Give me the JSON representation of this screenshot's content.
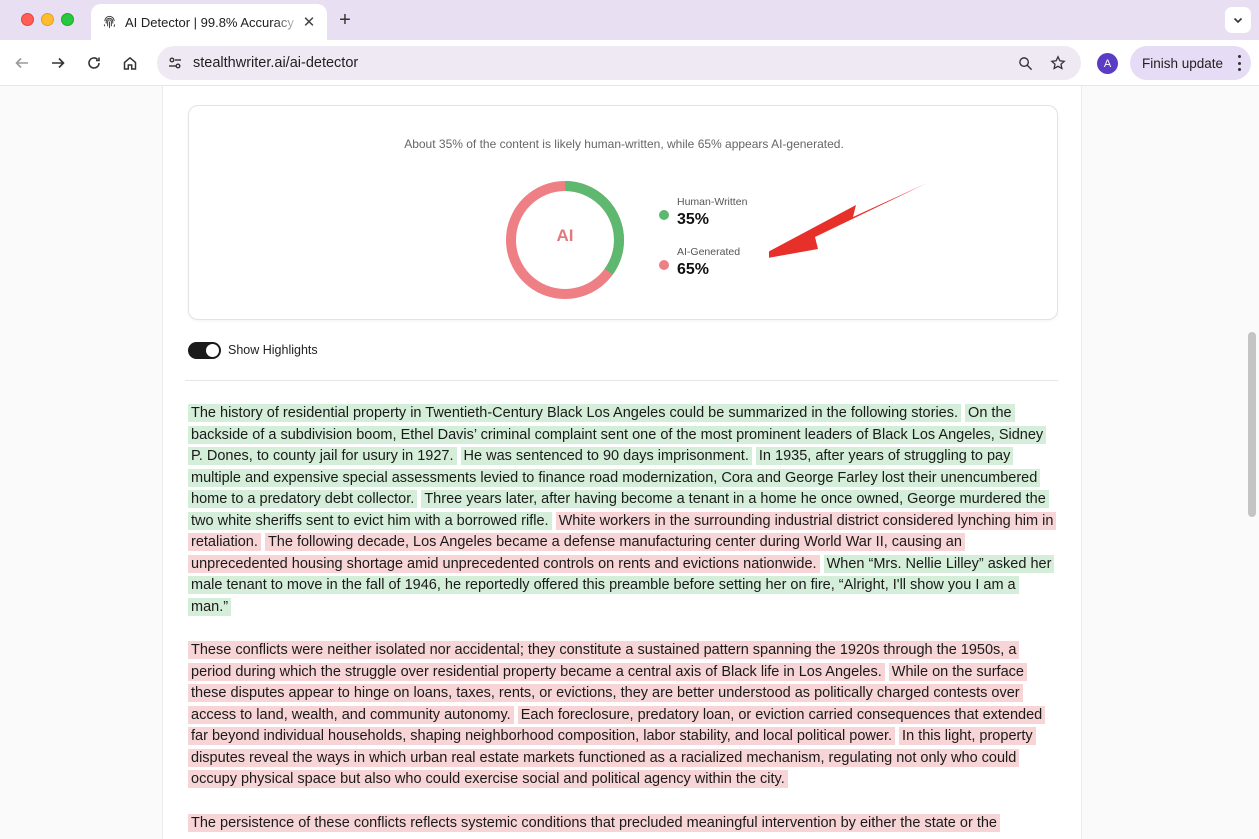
{
  "browser": {
    "tab_title": "AI Detector | 99.8% Accuracy",
    "url": "stealthwriter.ai/ai-detector",
    "avatar_initial": "A",
    "finish_update_label": "Finish update"
  },
  "result": {
    "summary": "About 35% of the content is likely human-written, while 65% appears AI-generated.",
    "donut_label": "AI",
    "human_pct": 35,
    "ai_pct": 65,
    "legend": [
      {
        "name": "Human-Written",
        "value": "35%",
        "color": "#5fb86f"
      },
      {
        "name": "AI-Generated",
        "value": "65%",
        "color": "#ee7f84"
      }
    ],
    "colors": {
      "human": "#5fb86f",
      "ai": "#ee7f84",
      "arrow": "#e8302a"
    }
  },
  "highlights_toggle": {
    "label": "Show Highlights",
    "on": true
  },
  "paragraphs": [
    [
      {
        "type": "human",
        "text": "The history of residential property in Twentieth-Century Black Los Angeles could be summarized in the following stories."
      },
      {
        "type": "human",
        "text": "On the backside of a subdivision boom, Ethel Davis’ criminal complaint sent one of the most prominent leaders of Black Los Angeles, Sidney P. Dones, to county jail for usury in 1927."
      },
      {
        "type": "human",
        "text": "He was sentenced to 90 days imprisonment."
      },
      {
        "type": "human",
        "text": "In 1935, after years of struggling to pay multiple and expensive special assessments levied to finance road modernization, Cora and George Farley lost their unencumbered home to a predatory debt collector."
      },
      {
        "type": "human",
        "text": "Three years later, after having become a tenant in a home he once owned, George murdered the two white sheriffs sent to evict him with a borrowed rifle."
      },
      {
        "type": "ai",
        "text": "White workers in the surrounding industrial district considered lynching him in retaliation."
      },
      {
        "type": "ai",
        "text": "The following decade, Los Angeles became a defense manufacturing center during World War II, causing an unprecedented housing shortage amid unprecedented controls on rents and evictions nationwide."
      },
      {
        "type": "human",
        "text": "When “Mrs. Nellie Lilley” asked her male tenant to move in the fall of 1946, he reportedly offered this preamble before setting her on fire, “Alright, I'll show you I am a man.”"
      }
    ],
    [
      {
        "type": "ai",
        "text": "These conflicts were neither isolated nor accidental; they constitute a sustained pattern spanning the 1920s through the 1950s, a period during which the struggle over residential property became a central axis of Black life in Los Angeles."
      },
      {
        "type": "ai",
        "text": "While on the surface these disputes appear to hinge on loans, taxes, rents, or evictions, they are better understood as politically charged contests over access to land, wealth, and community autonomy."
      },
      {
        "type": "ai",
        "text": "Each foreclosure, predatory loan, or eviction carried consequences that extended far beyond individual households, shaping neighborhood composition, labor stability, and local political power."
      },
      {
        "type": "ai",
        "text": "In this light, property disputes reveal the ways in which urban real estate markets functioned as a racialized mechanism, regulating not only who could occupy physical space but also who could exercise social and political agency within the city."
      }
    ],
    [
      {
        "type": "ai",
        "text": "The persistence of these conflicts reflects systemic conditions that precluded meaningful intervention by either the state or the"
      }
    ]
  ]
}
